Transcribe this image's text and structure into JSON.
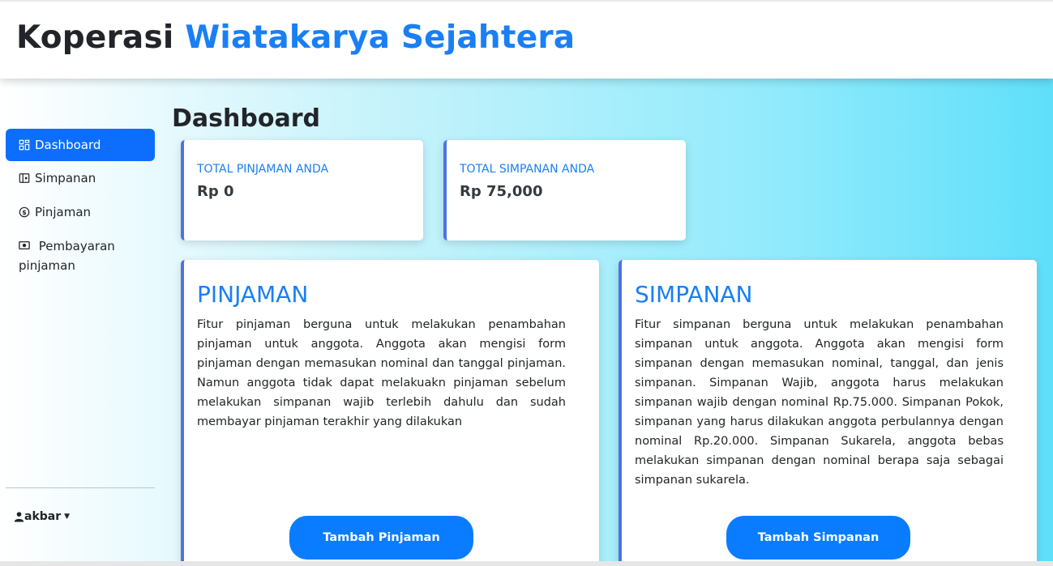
{
  "header": {
    "brand_part1": "Koperasi",
    "brand_part2": "Wiatakarya Sejahtera"
  },
  "sidebar": {
    "items": [
      {
        "label": "Dashboard",
        "icon": "grid-icon",
        "active": true
      },
      {
        "label": "Simpanan",
        "icon": "wallet-icon",
        "active": false
      },
      {
        "label": "Pinjaman",
        "icon": "coin-icon",
        "active": false
      },
      {
        "label": "Pembayaran pinjaman",
        "icon": "cash-icon",
        "active": false
      }
    ],
    "user_name": "akbar"
  },
  "main": {
    "page_title": "Dashboard",
    "stats": [
      {
        "label": "TOTAL PINJAMAN ANDA",
        "value": "Rp 0"
      },
      {
        "label": "TOTAL SIMPANAN ANDA",
        "value": "Rp 75,000"
      }
    ],
    "cards": [
      {
        "title": "PINJAMAN",
        "text": "Fitur pinjaman berguna untuk melakukan penambahan pinjaman untuk anggota. Anggota akan mengisi form pinjaman dengan memasukan nominal dan tanggal pinjaman. Namun anggota tidak dapat melakuakn pinjaman sebelum melakukan simpanan wajib terlebih dahulu dan sudah membayar pinjaman terakhir yang dilakukan",
        "button": "Tambah Pinjaman"
      },
      {
        "title": "SIMPANAN",
        "text": "Fitur simpanan berguna untuk melakukan penambahan simpanan untuk anggota. Anggota akan mengisi form simpanan dengan memasukan nominal, tanggal, dan jenis simpanan. Simpanan Wajib, anggota harus melakukan simpanan wajib dengan nominal Rp.75.000. Simpanan Pokok, simpanan yang harus dilakukan anggota perbulannya dengan nominal Rp.20.000. Simpanan Sukarela, anggota bebas melakukan simpanan dengan nominal berapa saja sebagai simpanan sukarela.",
        "button": "Tambah Simpanan"
      }
    ]
  },
  "colors": {
    "accent": "#1a7ff5",
    "primary_button": "#0a7cff",
    "card_border": "#4e73df"
  }
}
